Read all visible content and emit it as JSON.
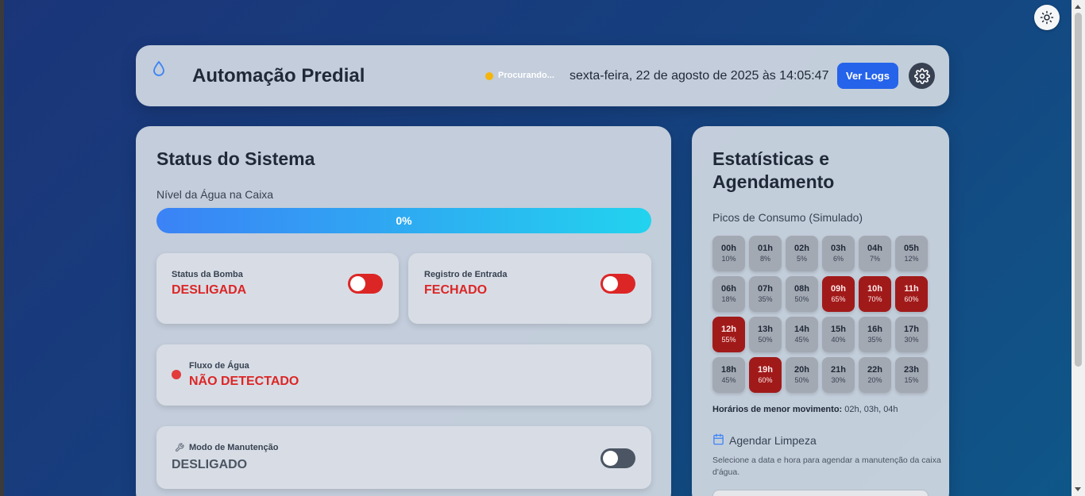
{
  "header": {
    "title": "Automação Predial",
    "connection_status": "Procurando...",
    "datetime": "sexta-feira, 22 de agosto de 2025 às 14:05:47",
    "logs_button": "Ver Logs"
  },
  "status": {
    "title": "Status do Sistema",
    "water_level_label": "Nível da Água na Caixa",
    "water_level_value": "0%",
    "water_level_fraction": 0,
    "pump": {
      "label": "Status da Bomba",
      "value": "DESLIGADA",
      "on": false
    },
    "valve": {
      "label": "Registro de Entrada",
      "value": "FECHADO",
      "on": false
    },
    "flow": {
      "label": "Fluxo de Água",
      "value": "NÃO DETECTADO"
    },
    "maintenance": {
      "label": "Modo de Manutenção",
      "value": "DESLIGADO",
      "on": false
    }
  },
  "stats": {
    "title": "Estatísticas e Agendamento",
    "peaks_label": "Picos de Consumo (Simulado)",
    "hours": [
      {
        "h": "00h",
        "p": "10%",
        "peak": false
      },
      {
        "h": "01h",
        "p": "8%",
        "peak": false
      },
      {
        "h": "02h",
        "p": "5%",
        "peak": false
      },
      {
        "h": "03h",
        "p": "6%",
        "peak": false
      },
      {
        "h": "04h",
        "p": "7%",
        "peak": false
      },
      {
        "h": "05h",
        "p": "12%",
        "peak": false
      },
      {
        "h": "06h",
        "p": "18%",
        "peak": false
      },
      {
        "h": "07h",
        "p": "35%",
        "peak": false
      },
      {
        "h": "08h",
        "p": "50%",
        "peak": false
      },
      {
        "h": "09h",
        "p": "65%",
        "peak": true
      },
      {
        "h": "10h",
        "p": "70%",
        "peak": true
      },
      {
        "h": "11h",
        "p": "60%",
        "peak": true
      },
      {
        "h": "12h",
        "p": "55%",
        "peak": true
      },
      {
        "h": "13h",
        "p": "50%",
        "peak": false
      },
      {
        "h": "14h",
        "p": "45%",
        "peak": false
      },
      {
        "h": "15h",
        "p": "40%",
        "peak": false
      },
      {
        "h": "16h",
        "p": "35%",
        "peak": false
      },
      {
        "h": "17h",
        "p": "30%",
        "peak": false
      },
      {
        "h": "18h",
        "p": "45%",
        "peak": false
      },
      {
        "h": "19h",
        "p": "60%",
        "peak": true
      },
      {
        "h": "20h",
        "p": "50%",
        "peak": false
      },
      {
        "h": "21h",
        "p": "30%",
        "peak": false
      },
      {
        "h": "22h",
        "p": "20%",
        "peak": false
      },
      {
        "h": "23h",
        "p": "15%",
        "peak": false
      }
    ],
    "low_movement_label": "Horários de menor movimento:",
    "low_movement_value": " 02h, 03h, 04h",
    "schedule_title": "Agendar Limpeza",
    "schedule_desc": "Selecione a data e hora para agendar a manutenção da caixa d'água."
  },
  "colors": {
    "accent": "#2563eb",
    "danger": "#dc2626",
    "peak": "#a11a1a",
    "status_searching": "#f5b50b"
  }
}
